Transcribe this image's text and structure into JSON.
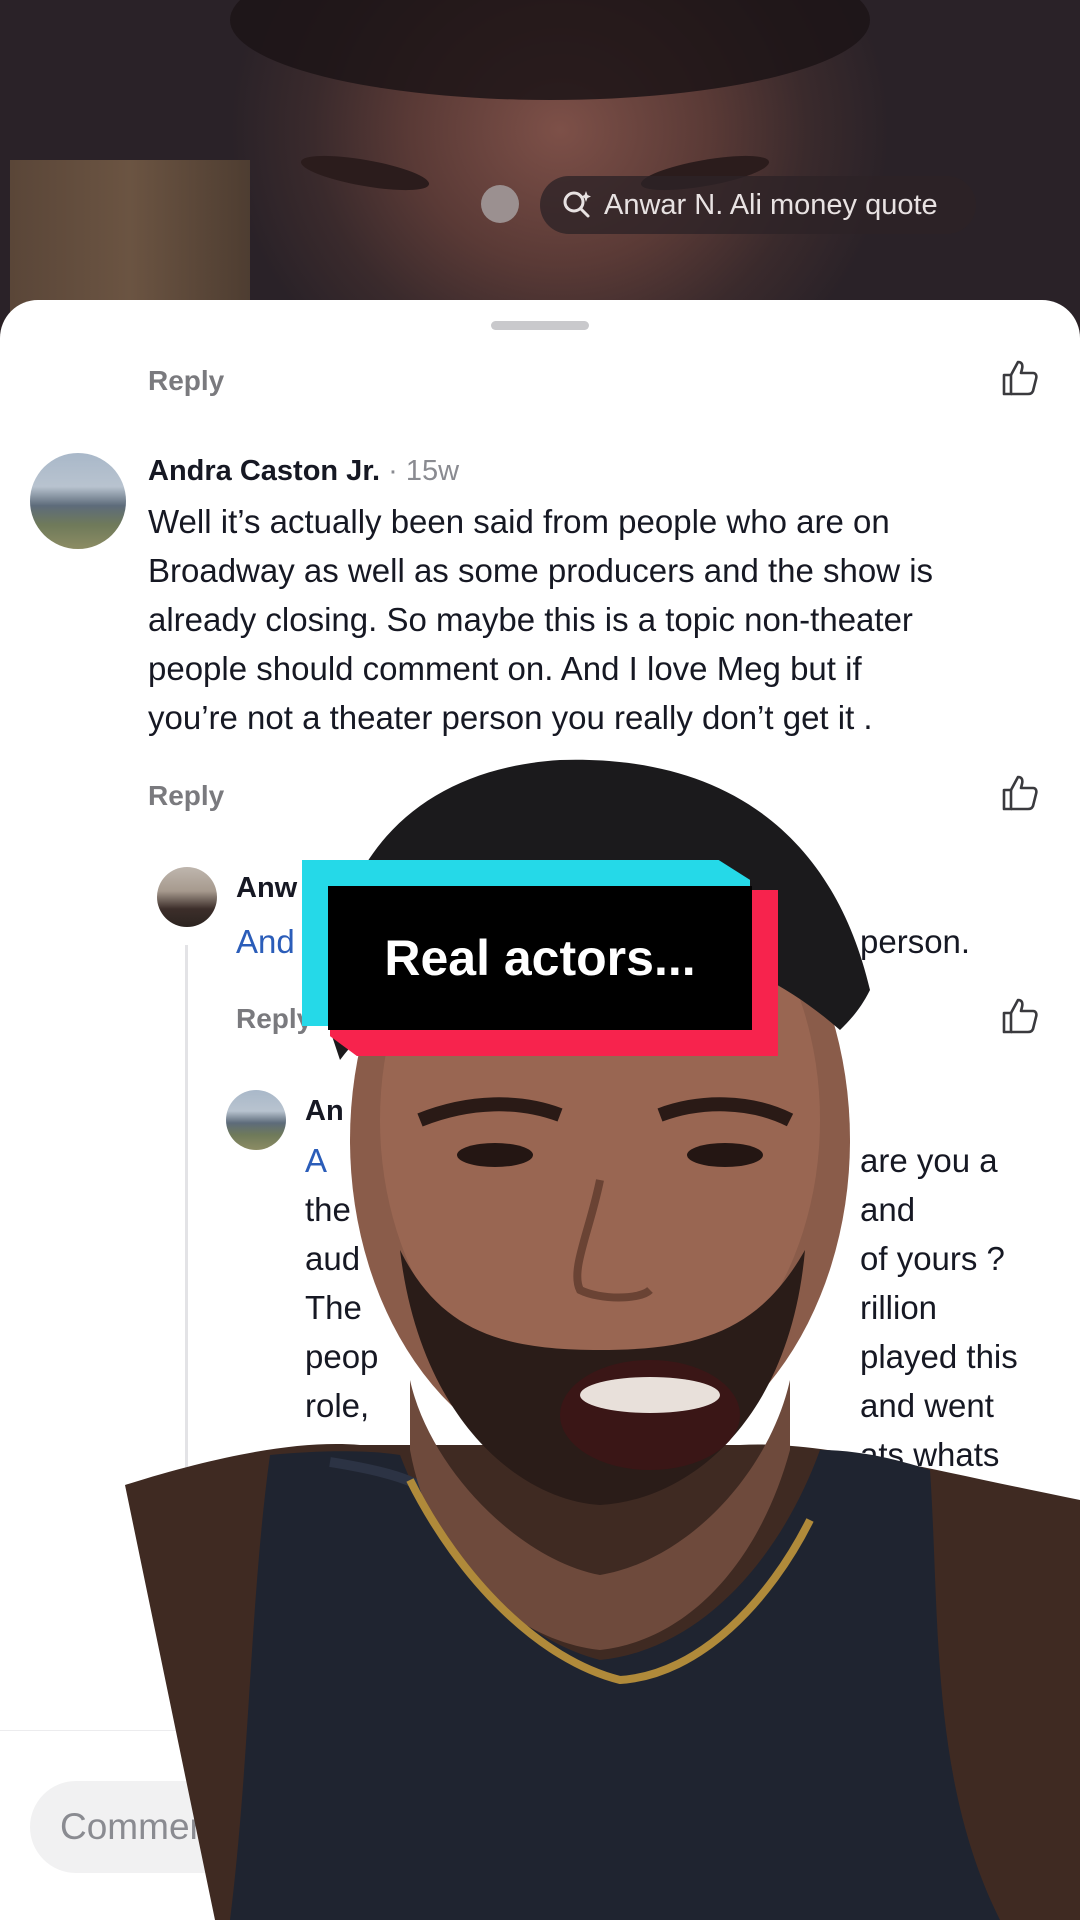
{
  "search": {
    "query": "Anwar N. Ali money quote"
  },
  "comments": {
    "top_reply_label": "Reply",
    "comment1": {
      "author": "Andra Caston Jr.",
      "time": "· 15w",
      "lines": [
        "Well it’s actually been said from people who are on",
        "Broadway as well as some producers and the show is",
        "already closing. So maybe this is a topic non-theater",
        "people should comment on. And I love Meg but if",
        "you’re not a theater person you really don’t get it ."
      ],
      "reply_label": "Reply"
    },
    "reply1": {
      "author_partial": "Anw",
      "mention_partial": "And",
      "text_tail": "person.",
      "reply_label": "Reply"
    },
    "reply2": {
      "author_partial": "An",
      "mention_partial": "A",
      "left_fragments": [
        "the",
        "aud",
        "The",
        "peop",
        "role,"
      ],
      "right_fragments": [
        "are you a",
        "and",
        "of yours ?",
        "rillion",
        "played this",
        "and went",
        "ats whats"
      ]
    }
  },
  "composer": {
    "placeholder": "Commen"
  },
  "overlay": {
    "caption": "Real actors..."
  },
  "colors": {
    "caption_bg": "#000000",
    "caption_cyan": "#25d9e8",
    "caption_red": "#f7234d",
    "mention": "#2b5db9"
  }
}
